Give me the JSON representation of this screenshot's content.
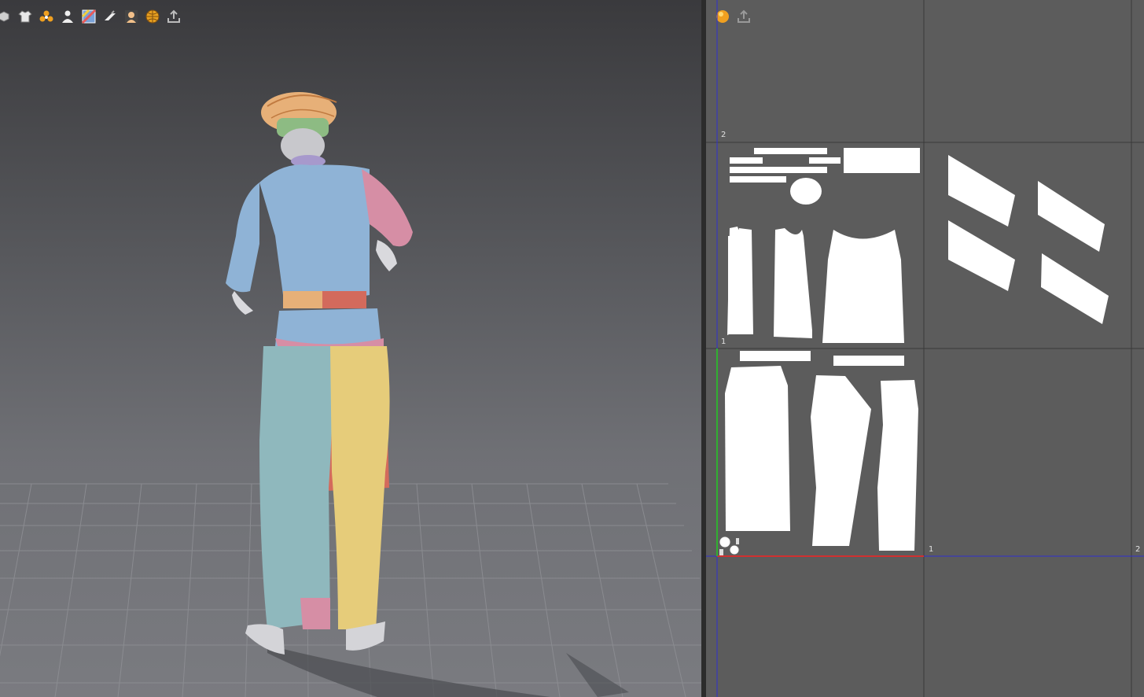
{
  "toolbar_3d": {
    "icons": [
      "object-icon",
      "garment-shirt-icon",
      "particle-icon",
      "avatar-icon",
      "texture-icon",
      "fold-icon",
      "skin-icon",
      "globe-icon",
      "export-icon"
    ]
  },
  "toolbar_2d": {
    "icons": [
      "sphere-icon",
      "export-icon"
    ]
  },
  "grid_labels": {
    "top_left": "2",
    "mid_left": "1",
    "bottom_center": "1",
    "bottom_right": "2"
  },
  "colors": {
    "viewport_3d_bg": "#56575b",
    "viewport_2d_bg": "#5c5c5c",
    "pattern_piece": "#ffffff",
    "shirt_blue": "#8fb3d6",
    "sleeve_pink": "#d68ea5",
    "pants_teal": "#8fb8bd",
    "pants_yellow": "#e6cc7a",
    "sash_red": "#d36a5c",
    "hat_orange": "#e7b078",
    "headband_green": "#8dbb83",
    "x_axis": "#d03030",
    "y_axis": "#30b030",
    "guide_blue": "#3030d0"
  }
}
